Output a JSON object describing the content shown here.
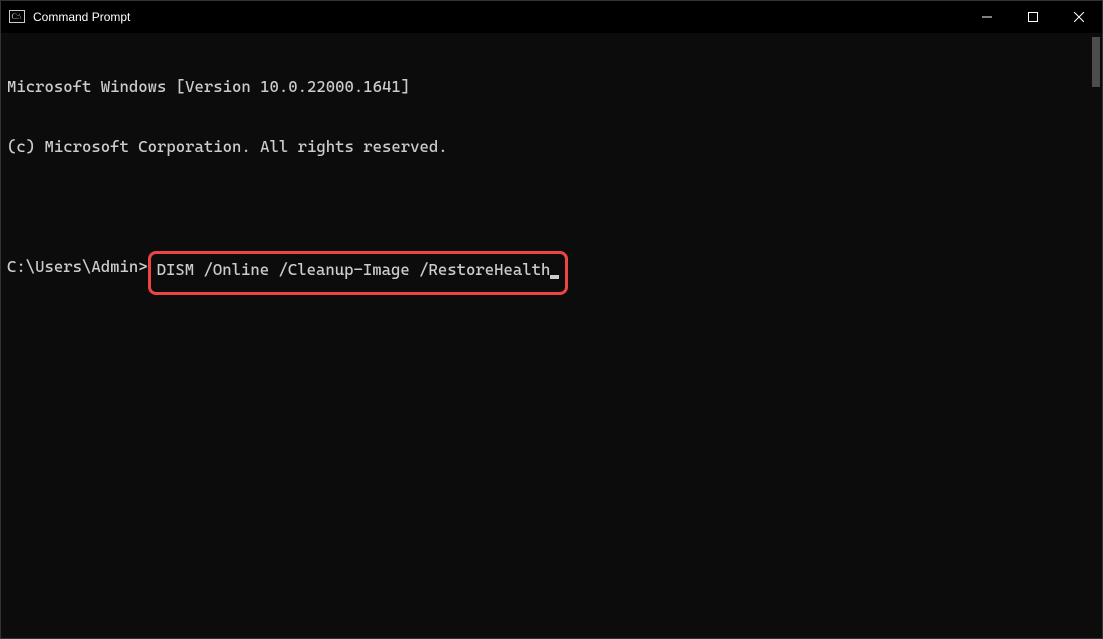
{
  "titlebar": {
    "title": "Command Prompt"
  },
  "terminal": {
    "line1": "Microsoft Windows [Version 10.0.22000.1641]",
    "line2": "(c) Microsoft Corporation. All rights reserved.",
    "prompt": "C:\\Users\\Admin>",
    "command": "DISM /Online /Cleanup-Image /RestoreHealth"
  }
}
